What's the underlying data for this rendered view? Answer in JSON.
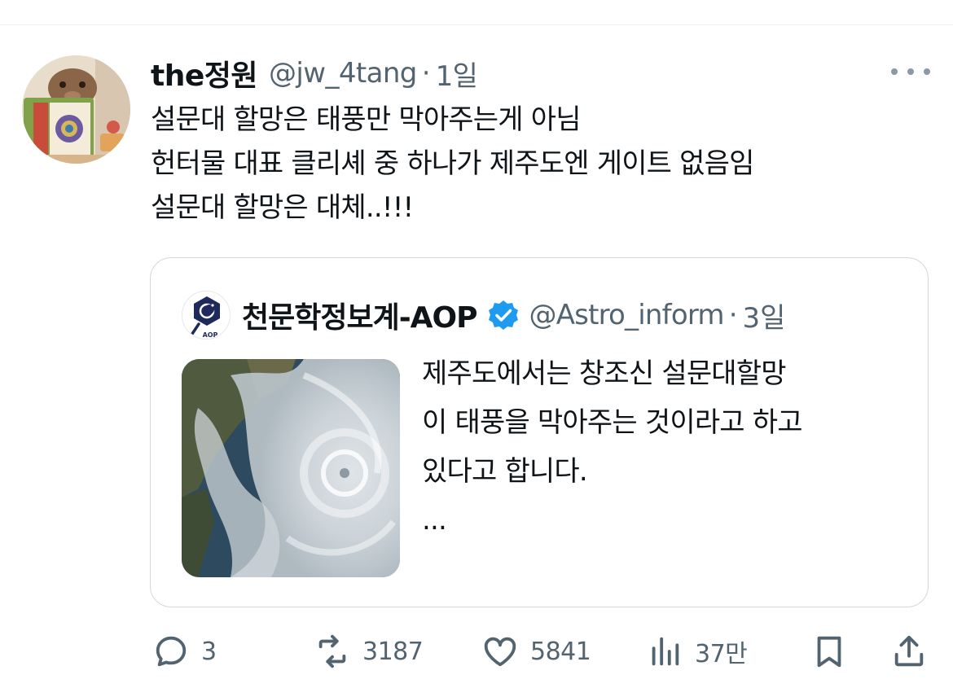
{
  "tweet": {
    "author_name": "the정원",
    "handle": "@jw_4tang",
    "separator": "·",
    "time": "1일",
    "more_icon": "more-icon",
    "lines": [
      "설문대 할망은 태풍만 막아주는게 아님",
      "헌터물 대표 클리셰 중 하나가 제주도엔 게이트 없음임",
      "설문대 할망은 대체..!!!"
    ]
  },
  "quote": {
    "author_name": "천문학정보계-AOP",
    "verified_icon": "verified-badge-icon",
    "handle": "@Astro_inform",
    "separator": "·",
    "time": "3일",
    "logo_text": "AOP",
    "lines": [
      "제주도에서는 창조신 설문대할망",
      "이 태풍을 막아주는 것이라고 하고",
      "있다고 합니다.",
      "..."
    ]
  },
  "actions": {
    "reply_count": "3",
    "retweet_count": "3187",
    "like_count": "5841",
    "views_count": "37만"
  },
  "colors": {
    "text": "#0f1419",
    "secondary": "#536471",
    "verified": "#1d9bf0",
    "border": "#cfd9de"
  }
}
